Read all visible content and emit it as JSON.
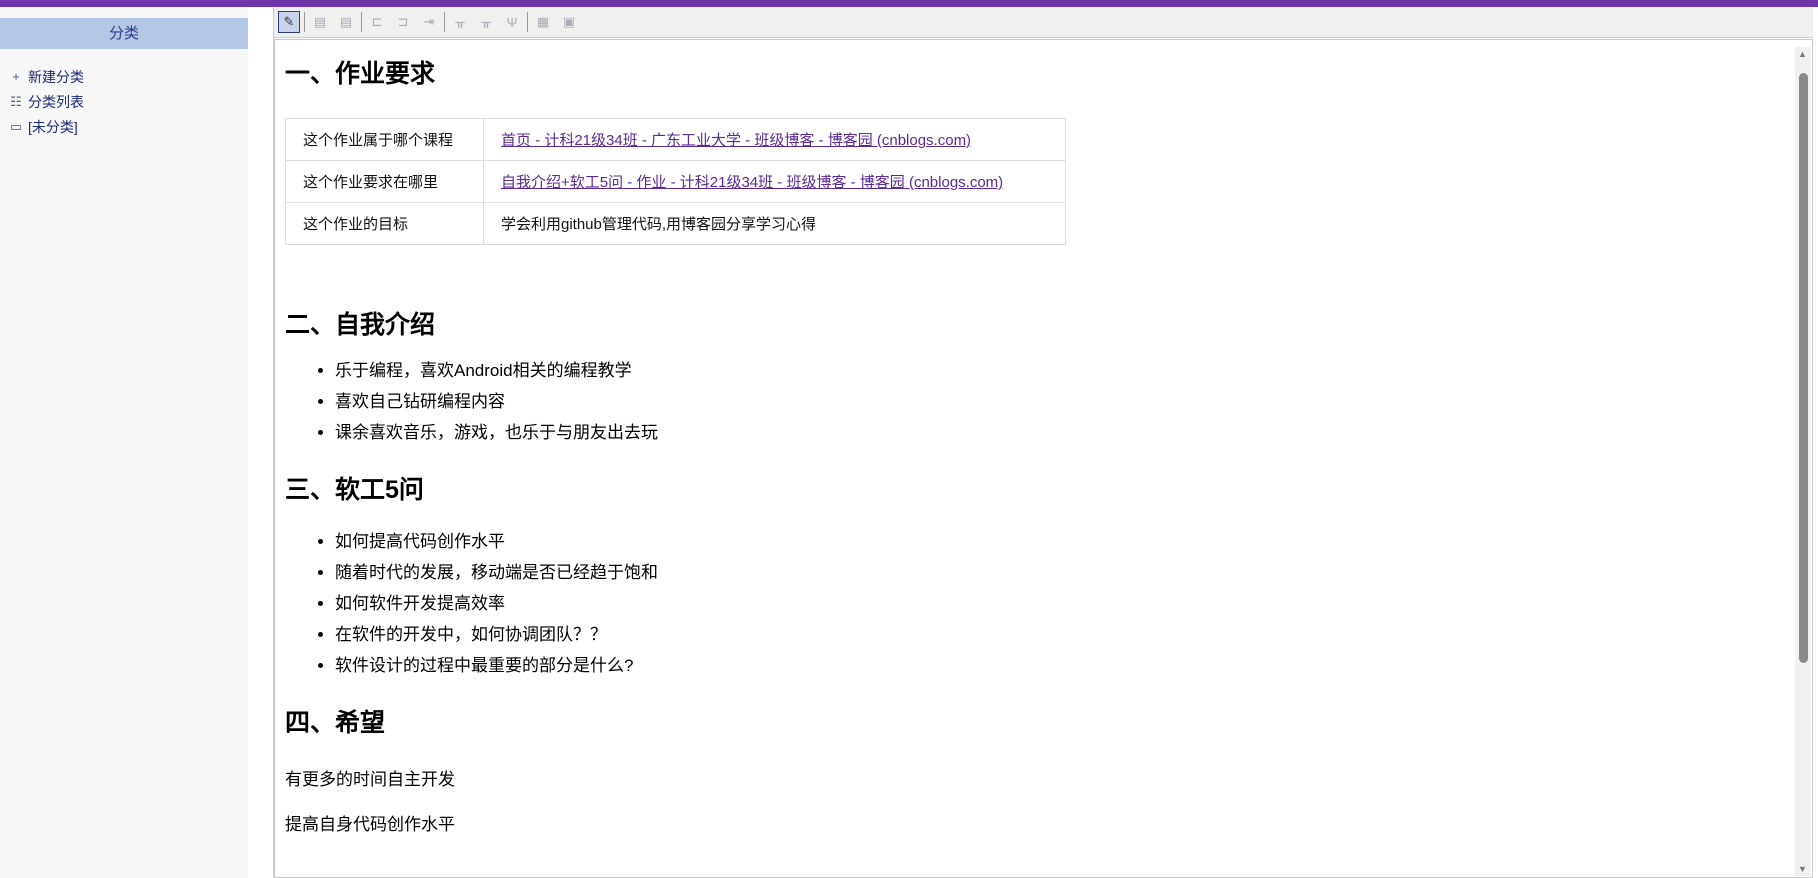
{
  "sidebar": {
    "title": "分类",
    "items": [
      {
        "icon": "plus-icon",
        "label": "新建分类"
      },
      {
        "icon": "list-icon",
        "label": "分类列表"
      },
      {
        "icon": "folder-icon",
        "label": "[未分类]"
      }
    ]
  },
  "toolbar": {
    "buttons": [
      "edit-table",
      "row-above",
      "row-below",
      "insert-col-left",
      "insert-col-right",
      "delete-col",
      "split-cell-1",
      "split-cell-2",
      "merge-cell",
      "table-props",
      "cell-props"
    ]
  },
  "content": {
    "h1": "一、作业要求",
    "table": [
      {
        "label": "这个作业属于哪个课程",
        "value": "首页 - 计科21级34班 - 广东工业大学 - 班级博客 - 博客园 (cnblogs.com)",
        "link": true
      },
      {
        "label": "这个作业要求在哪里",
        "value": "自我介绍+软工5问 - 作业 - 计科21级34班 - 班级博客 - 博客园 (cnblogs.com)",
        "link": true
      },
      {
        "label": "这个作业的目标",
        "value": "学会利用github管理代码,用博客园分享学习心得",
        "link": false
      }
    ],
    "h2": "二、自我介绍",
    "intro": [
      "乐于编程，喜欢Android相关的编程教学",
      "喜欢自己钻研编程内容",
      "课余喜欢音乐，游戏，也乐于与朋友出去玩"
    ],
    "h3": "三、软工5问",
    "questions": [
      "如何提高代码创作水平",
      "随着时代的发展，移动端是否已经趋于饱和",
      "如何软件开发提高效率",
      "在软件的开发中，如何协调团队？？",
      "软件设计的过程中最重要的部分是什么?"
    ],
    "h4": "四、希望",
    "hopes": [
      "有更多的时间自主开发",
      "提高自身代码创作水平"
    ]
  }
}
